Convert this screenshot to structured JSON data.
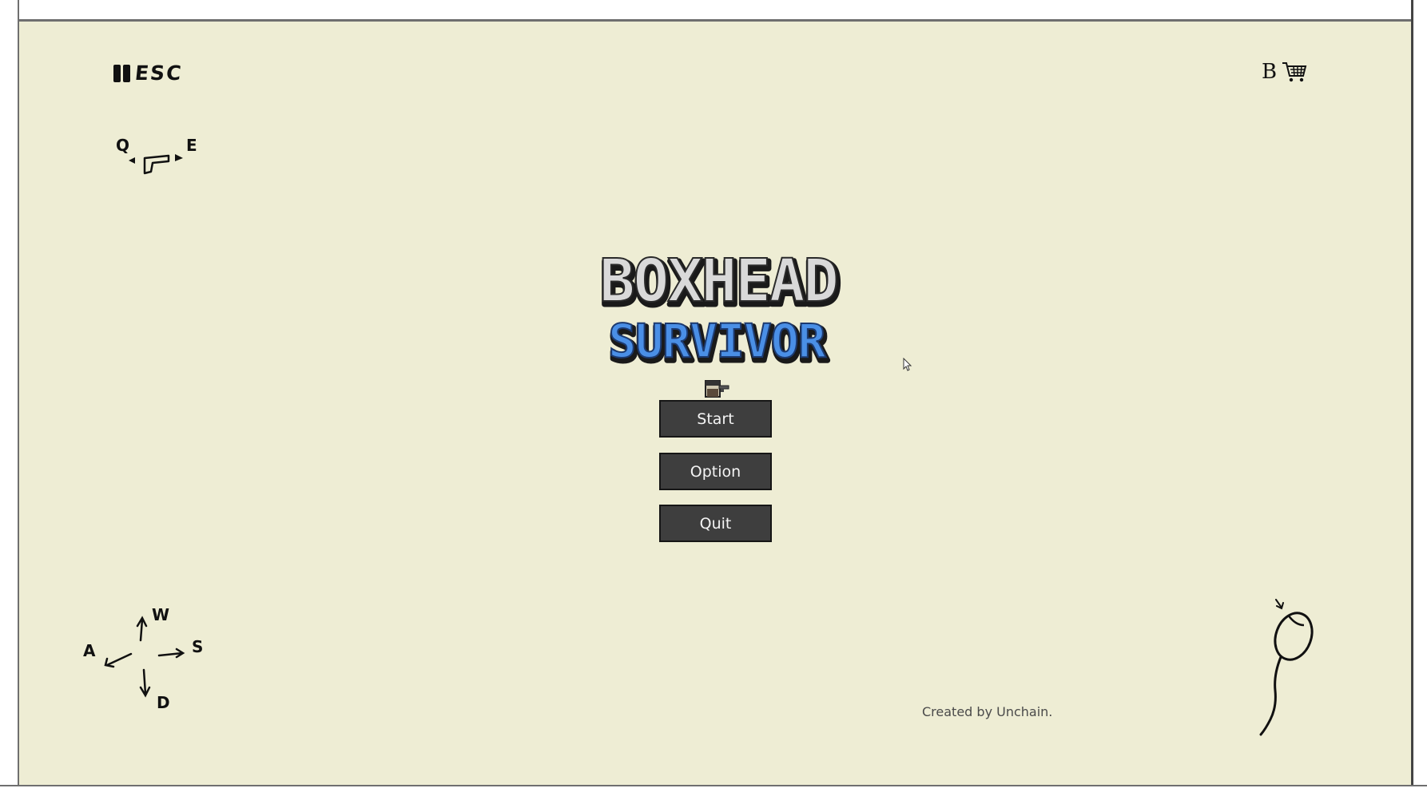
{
  "hud": {
    "pause_key": "ESC",
    "shop_key": "B",
    "weapon_prev_key": "Q",
    "weapon_next_key": "E",
    "move_keys": {
      "up": "W",
      "left": "A",
      "right": "S",
      "down": "D"
    }
  },
  "logo": {
    "line1": "BOXHEAD",
    "line2": "SURVIVOR"
  },
  "menu": {
    "start": "Start",
    "option": "Option",
    "quit": "Quit"
  },
  "credit": "Created by Unchain.",
  "colors": {
    "background": "#eeedd4",
    "button": "#3e3e3e",
    "logo_top": "#d9d9d9",
    "logo_bottom": "#4a8fe6"
  },
  "icons": [
    "pause-icon",
    "cart-icon",
    "pistol-icon",
    "mouse-icon",
    "player-character-icon",
    "cursor-icon"
  ]
}
